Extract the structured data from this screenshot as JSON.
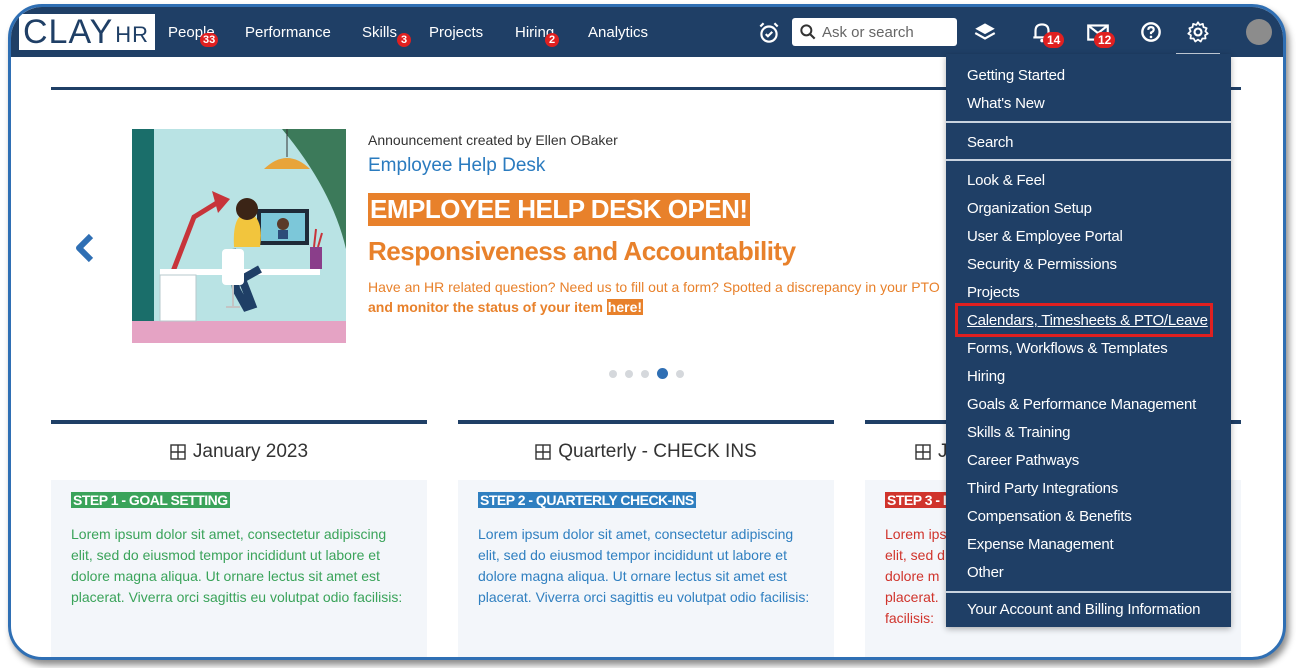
{
  "app": {
    "logo_big": "CLAY",
    "logo_small": "HR"
  },
  "nav": {
    "people": "People",
    "people_badge": "33",
    "performance": "Performance",
    "skills": "Skills",
    "skills_badge": "3",
    "projects": "Projects",
    "hiring": "Hiring",
    "hiring_badge": "2",
    "analytics": "Analytics",
    "search_placeholder": "Ask or search",
    "notifications_badge": "14",
    "messages_badge": "12"
  },
  "announcement": {
    "created_by": "Announcement created by Ellen OBaker",
    "title": "Employee Help Desk",
    "headline": "EMPLOYEE HELP DESK OPEN!",
    "subheadline": "Responsiveness and Accountability",
    "body_line1": "Have an HR related question? Need us to fill out a form? Spotted a discrepancy in your PTO",
    "body_line2": "and monitor the status of your item",
    "link": "here!",
    "slide_index": 4,
    "slide_count": 5
  },
  "cards": [
    {
      "title": "January 2023",
      "step": "STEP 1 - GOAL SETTING",
      "step_color": "#3aa35a",
      "text_color": "#3aa35a",
      "text": "Lorem ipsum dolor sit amet, consectetur adipiscing elit, sed do eiusmod tempor incididunt ut labore et dolore magna aliqua. Ut ornare lectus sit amet est placerat. Viverra orci sagittis eu volutpat odio facilisis:"
    },
    {
      "title": "Quarterly - CHECK INS",
      "step": "STEP 2 - QUARTERLY CHECK-INS",
      "step_color": "#2f7fc0",
      "text_color": "#2f7fc0",
      "text": "Lorem ipsum dolor sit amet, consectetur adipiscing elit, sed do eiusmod tempor incididunt ut labore et dolore magna aliqua. Ut ornare lectus sit amet est placerat. Viverra orci sagittis eu volutpat odio facilisis:"
    },
    {
      "title": "J",
      "step": "STEP 3 - I",
      "step_color": "#d0342c",
      "text_color": "#d0342c",
      "text_lines": [
        "Lorem ips",
        "elit, sed d",
        "dolore m",
        "placerat.",
        "facilisis:"
      ]
    }
  ],
  "settings_menu": {
    "items": [
      "Getting Started",
      "What's New",
      "Search",
      "Look & Feel",
      "Organization Setup",
      "User & Employee Portal",
      "Security & Permissions",
      "Projects",
      "Calendars, Timesheets & PTO/Leave",
      "Forms, Workflows & Templates",
      "Hiring",
      "Goals & Performance Management",
      "Skills & Training",
      "Career Pathways",
      "Third Party Integrations",
      "Compensation & Benefits",
      "Expense Management",
      "Other",
      "Your Account and Billing Information"
    ],
    "highlighted_item": "Calendars, Timesheets & PTO/Leave"
  },
  "colors": {
    "navy": "#1f3f66",
    "accent_orange": "#e8812b",
    "highlight_red": "#e02020",
    "link_blue": "#2a7bbf"
  }
}
